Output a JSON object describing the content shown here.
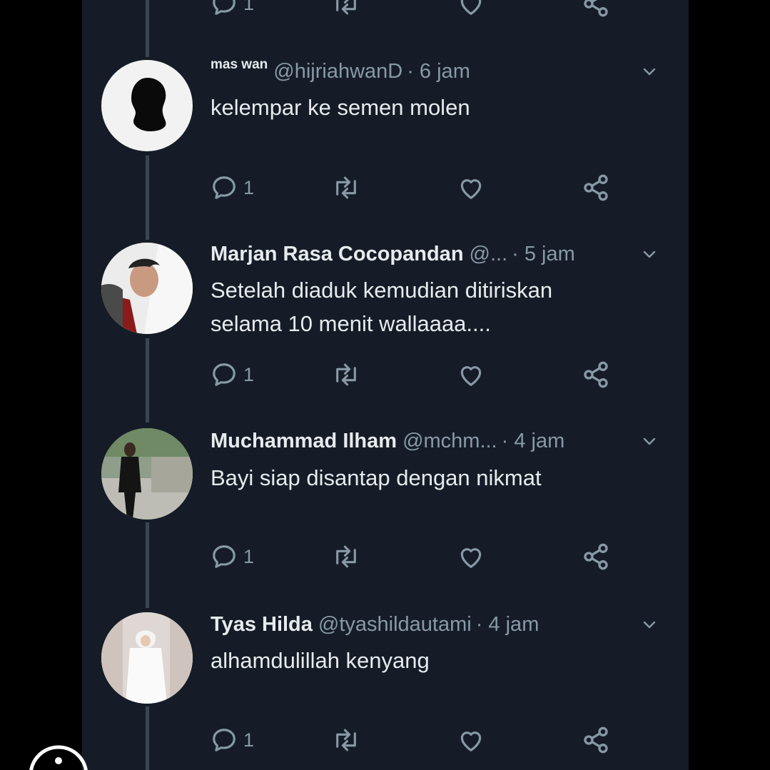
{
  "tweets": [
    {
      "name": "mas wan",
      "handle": "@hijriahwanD",
      "time": "· 6 jam",
      "lines": [
        "kelempar ke semen molen"
      ],
      "reply_count": "1"
    },
    {
      "name": "Marjan Rasa Cocopandan",
      "handle": "@...",
      "time": "· 5 jam",
      "lines": [
        "Setelah diaduk kemudian ditiriskan",
        "selama 10 menit wallaaaa...."
      ],
      "reply_count": "1"
    },
    {
      "name": "Muchammad Ilham",
      "handle": "@mchm...",
      "time": "· 4 jam",
      "lines": [
        "Bayi siap disantap dengan nikmat"
      ],
      "reply_count": "1"
    },
    {
      "name": "Tyas Hilda",
      "handle": "@tyashildautami",
      "time": "· 4 jam",
      "lines": [
        "alhamdulillah kenyang"
      ],
      "reply_count": "1"
    }
  ],
  "top_partial": {
    "reply_count": "1"
  },
  "icons": {
    "reply": "reply-icon",
    "retweet": "retweet-icon",
    "like": "heart-icon",
    "share": "share-icon",
    "more": "chevron-down-icon"
  },
  "colors": {
    "background": "#151c27",
    "text": "#e7ebee",
    "muted": "#8899a6",
    "thread_line": "#3a4552"
  }
}
